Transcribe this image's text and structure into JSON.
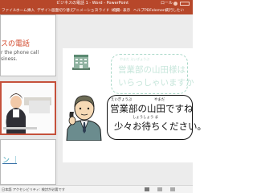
{
  "window": {
    "title": "ビジネスの電話 1 - Word - PowerPoint",
    "account_label": "ロール",
    "tabs": [
      "ファイル",
      "ホーム",
      "挿入",
      "デザイン",
      "画面切り替え",
      "アニメーション",
      "スライド ショー",
      "校閲",
      "表示",
      "ヘルプ",
      "PDFelement",
      "実行したい"
    ]
  },
  "slides_panel": {
    "slide1": {
      "heading": "スの電話",
      "subtitle_line1": "r the phone call",
      "subtitle_line2": "siness."
    },
    "slide3": {
      "title": "ン ｜"
    }
  },
  "slide": {
    "bubble_top": {
      "ruby": "やまだ えいぎょうぶ",
      "line1": "営業部の山田様は",
      "line2": "いらっしゃいますか"
    },
    "bubble_main": {
      "ruby1": "えいぎょうぶ",
      "ruby1b": "やまだ",
      "line1": "営業部の山田ですね",
      "ruby2": "しょうしょう ま",
      "line2": "少々お待ちください。"
    }
  },
  "status": {
    "text": "日本語 アクセシビリティ: 検討が必要です"
  },
  "colors": {
    "accent": "#b7472a",
    "bubble_border": "#a9d8c8"
  },
  "icons": [
    "notes-icon",
    "normal-view-icon",
    "sorter-view-icon",
    "building-icon",
    "businessman-icon"
  ]
}
